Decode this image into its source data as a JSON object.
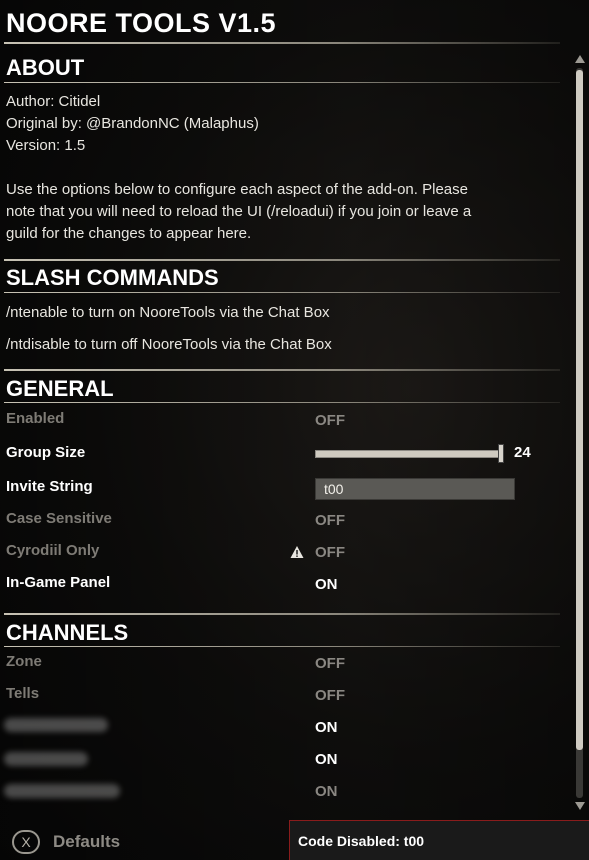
{
  "title": "NOORE TOOLS V1.5",
  "about": {
    "heading": "ABOUT",
    "author": "Author: Citidel",
    "original": "Original by: @BrandonNC (Malaphus)",
    "version": "Version: 1.5",
    "desc_line1": "Use the options below to configure each aspect of the add-on. Please",
    "desc_line2": "note that you will need to reload the UI (/reloadui) if you join or leave a",
    "desc_line3": "guild for the changes to appear here."
  },
  "slash": {
    "heading": "SLASH COMMANDS",
    "enable": "/ntenable to turn on NooreTools via the Chat Box",
    "disable": "/ntdisable to turn off NooreTools via the Chat Box"
  },
  "general": {
    "heading": "GENERAL",
    "enabled": {
      "label": "Enabled",
      "value": "OFF"
    },
    "group_size": {
      "label": "Group Size",
      "value": "24",
      "fraction": 0.99
    },
    "invite_string": {
      "label": "Invite String",
      "value": "t00"
    },
    "case_sensitive": {
      "label": "Case Sensitive",
      "value": "OFF"
    },
    "cyrodiil_only": {
      "label": "Cyrodiil Only",
      "value": "OFF",
      "icon": "warning-icon"
    },
    "in_game_panel": {
      "label": "In-Game Panel",
      "value": "ON"
    }
  },
  "channels": {
    "heading": "CHANNELS",
    "zone": {
      "label": "Zone",
      "value": "OFF"
    },
    "tells": {
      "label": "Tells",
      "value": "OFF"
    },
    "guild1": {
      "value": "ON"
    },
    "guild2": {
      "value": "ON"
    },
    "guild3": {
      "value": "ON"
    }
  },
  "footer": {
    "key": "X",
    "defaults": "Defaults",
    "code_status": "Code Disabled: t00"
  },
  "colors": {
    "accent_border": "#8a1c1c",
    "enabled_text": "#ffffff",
    "disabled_text": "#7e7b75"
  }
}
